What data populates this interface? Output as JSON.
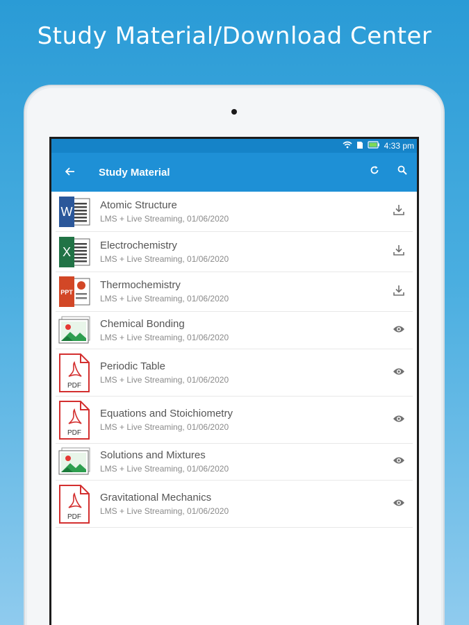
{
  "headline": "Study Material/Download Center",
  "status": {
    "wifi_icon": "wifi-icon",
    "battery_icon": "battery-icon",
    "time": "4:33 pm"
  },
  "appbar": {
    "title": "Study Material",
    "back_icon": "arrow-left-icon",
    "refresh_icon": "refresh-icon",
    "search_icon": "search-icon"
  },
  "colors": {
    "statusbar": "#1583c8",
    "appbar": "#1e90d6",
    "word": "#2b579a",
    "excel": "#217346",
    "ppt": "#d24726",
    "pdf": "#d32f2f",
    "image": "#2e9e4f"
  },
  "items": [
    {
      "name": "Atomic Structure",
      "meta": "LMS + Live Streaming, 01/06/2020",
      "type": "word",
      "action": "download-icon"
    },
    {
      "name": "Electrochemistry",
      "meta": "LMS + Live Streaming, 01/06/2020",
      "type": "excel",
      "action": "download-icon"
    },
    {
      "name": "Thermochemistry",
      "meta": "LMS + Live Streaming, 01/06/2020",
      "type": "ppt",
      "action": "download-icon"
    },
    {
      "name": "Chemical Bonding",
      "meta": "LMS + Live Streaming, 01/06/2020",
      "type": "image",
      "action": "eye-icon"
    },
    {
      "name": "Periodic Table",
      "meta": "LMS + Live Streaming, 01/06/2020",
      "type": "pdf",
      "action": "eye-icon"
    },
    {
      "name": "Equations and Stoichiometry",
      "meta": "LMS + Live Streaming, 01/06/2020",
      "type": "pdf",
      "action": "eye-icon"
    },
    {
      "name": "Solutions and Mixtures",
      "meta": "LMS + Live Streaming, 01/06/2020",
      "type": "image",
      "action": "eye-icon"
    },
    {
      "name": "Gravitational Mechanics",
      "meta": "LMS + Live Streaming, 01/06/2020",
      "type": "pdf",
      "action": "eye-icon"
    }
  ],
  "labels": {
    "word": "W",
    "excel": "X",
    "ppt": "PPT",
    "pdf": "PDF"
  }
}
